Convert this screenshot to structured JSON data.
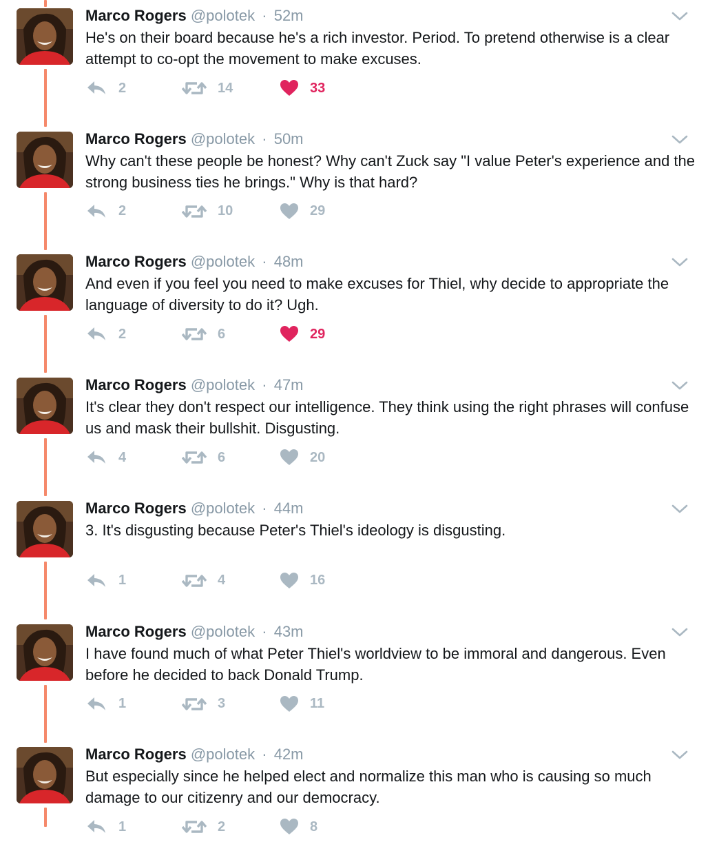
{
  "colors": {
    "thread_line": "#f5896b",
    "muted": "#aab8c2",
    "liked": "#e0245e",
    "name": "#14171a",
    "meta": "#8899a6"
  },
  "icons": {
    "reply": "reply-icon",
    "retweet": "retweet-icon",
    "like": "heart-icon",
    "menu": "chevron-down-icon",
    "avatar": "avatar"
  },
  "tweets": [
    {
      "name": "Marco Rogers",
      "handle": "@polotek",
      "sep": "·",
      "time": "52m",
      "text": "He's on their board because he's a rich investor. Period. To pretend otherwise is a clear attempt to co-opt the movement to make excuses.",
      "replies": "2",
      "retweets": "14",
      "likes": "33",
      "liked": true
    },
    {
      "name": "Marco Rogers",
      "handle": "@polotek",
      "sep": "·",
      "time": "50m",
      "text": "Why can't these people be honest? Why can't Zuck say \"I value Peter's experience and the strong business ties he brings.\" Why is that hard?",
      "replies": "2",
      "retweets": "10",
      "likes": "29",
      "liked": false
    },
    {
      "name": "Marco Rogers",
      "handle": "@polotek",
      "sep": "·",
      "time": "48m",
      "text": "And even if you feel you need to make excuses for Thiel, why decide to appropriate the language of diversity to do it? Ugh.",
      "replies": "2",
      "retweets": "6",
      "likes": "29",
      "liked": true
    },
    {
      "name": "Marco Rogers",
      "handle": "@polotek",
      "sep": "·",
      "time": "47m",
      "text": "It's clear they don't respect our intelligence. They think using the right phrases will confuse us and mask their bullshit. Disgusting.",
      "replies": "4",
      "retweets": "6",
      "likes": "20",
      "liked": false
    },
    {
      "name": "Marco Rogers",
      "handle": "@polotek",
      "sep": "·",
      "time": "44m",
      "text": "3. It's disgusting because Peter's Thiel's ideology is disgusting.",
      "replies": "1",
      "retweets": "4",
      "likes": "16",
      "liked": false
    },
    {
      "name": "Marco Rogers",
      "handle": "@polotek",
      "sep": "·",
      "time": "43m",
      "text": "I have found much of what Peter Thiel's worldview to be immoral and dangerous. Even before he decided to back Donald Trump.",
      "replies": "1",
      "retweets": "3",
      "likes": "11",
      "liked": false
    },
    {
      "name": "Marco Rogers",
      "handle": "@polotek",
      "sep": "·",
      "time": "42m",
      "text": "But especially since he helped elect and normalize this man who is causing so much damage to our citizenry and our democracy.",
      "replies": "1",
      "retweets": "2",
      "likes": "8",
      "liked": false
    }
  ]
}
